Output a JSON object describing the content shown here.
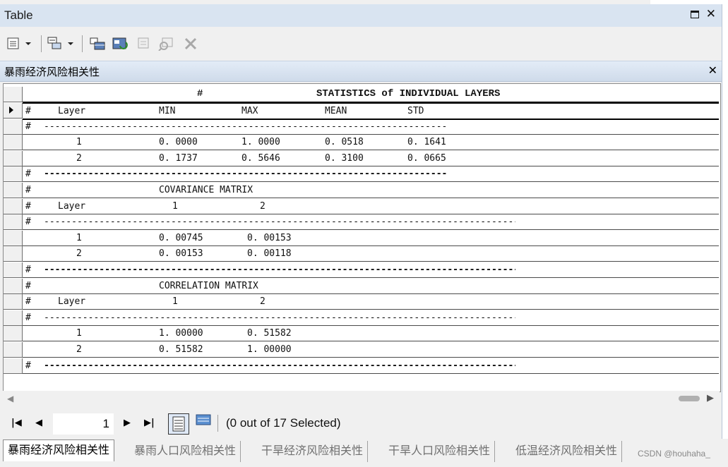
{
  "window": {
    "title": "Table"
  },
  "subwindow": {
    "name": "暴雨经济风险相关性"
  },
  "table": {
    "header": {
      "hash": "#",
      "title": "STATISTICS of INDIVIDUAL LAYERS"
    },
    "rows": [
      {
        "c1": "#",
        "c2": "Layer",
        "c3": "MIN",
        "c4": "MAX",
        "c5": "MEAN",
        "c6": "STD"
      },
      {
        "c1": "#",
        "dash": "-------------------------------------------------------------------------"
      },
      {
        "c2": "1",
        "c3": "0. 0000",
        "c4": "1. 0000",
        "c5": "0. 0518",
        "c6": "0. 1641"
      },
      {
        "c2": "2",
        "c3": "0. 1737",
        "c4": "0. 5646",
        "c5": "0. 3100",
        "c6": "0. 0665"
      },
      {
        "c1": "#",
        "dash": "-------------------------------------------------------------------------"
      },
      {
        "c1": "#",
        "c3": "COVARIANCE MATRIX"
      },
      {
        "c1": "#",
        "c2": "Layer",
        "c3": "1",
        "c4": "2"
      },
      {
        "c1": "#",
        "dash": "------------------------------------------------------------------------------------------"
      },
      {
        "c2": "1",
        "c3": "0. 00745",
        "c4": "0. 00153"
      },
      {
        "c2": "2",
        "c3": "0. 00153",
        "c4": "0. 00118"
      },
      {
        "c1": "#",
        "dash": "------------------------------------------------------------------------------------------"
      },
      {
        "c1": "#",
        "c3": "CORRELATION MATRIX"
      },
      {
        "c1": "#",
        "c2": "Layer",
        "c3": "1",
        "c4": "2"
      },
      {
        "c1": "#",
        "dash": "------------------------------------------------------------------------------------------"
      },
      {
        "c2": "1",
        "c3": "1. 00000",
        "c4": "0. 51582"
      },
      {
        "c2": "2",
        "c3": "0. 51582",
        "c4": "1. 00000"
      },
      {
        "c1": "#",
        "dash": "------------------------------------------------------------------------------------------"
      }
    ]
  },
  "navigation": {
    "current_record": "1",
    "selection_status": "(0 out of 17 Selected)"
  },
  "tabs": [
    "暴雨经济风险相关性",
    "暴雨人口风险相关性",
    "干旱经济风险相关性",
    "干旱人口风险相关性",
    "低温经济风险相关性"
  ],
  "watermark": "CSDN @houhaha_",
  "icons": [
    "table-options-icon",
    "related-tables-icon",
    "select-by-attributes-icon",
    "switch-selection-icon",
    "clear-selection-icon",
    "zoom-to-selected-icon",
    "delete-selected-icon"
  ]
}
